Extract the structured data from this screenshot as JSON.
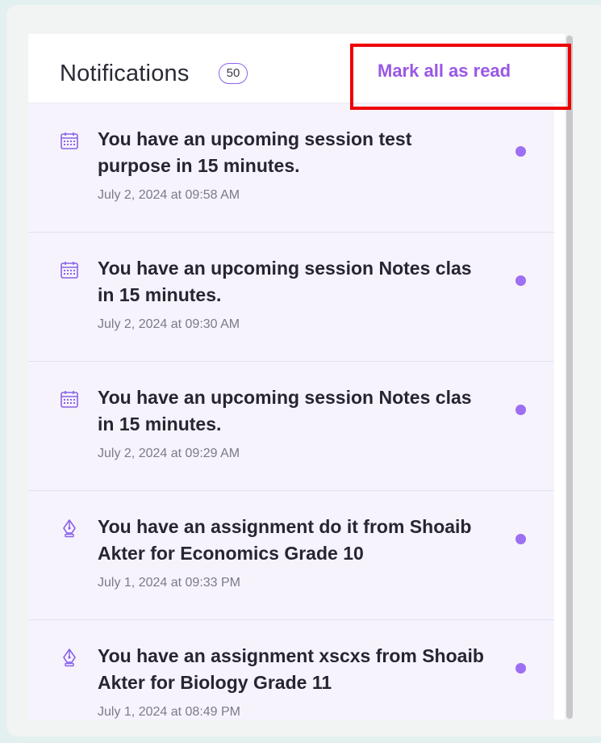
{
  "header": {
    "title": "Notifications",
    "count": "50",
    "mark_all_label": "Mark all as read"
  },
  "colors": {
    "accent": "#9a57e6",
    "unread_dot": "#9d6ff2",
    "list_background": "#f6f3fd",
    "highlight": "#ee0000"
  },
  "notifications": [
    {
      "icon": "calendar-icon",
      "message": "You have an upcoming session test purpose in 15 minutes.",
      "time": "July 2, 2024 at 09:58 AM",
      "unread": true
    },
    {
      "icon": "calendar-icon",
      "message": "You have an upcoming session Notes clas in 15 minutes.",
      "time": "July 2, 2024 at 09:30 AM",
      "unread": true
    },
    {
      "icon": "calendar-icon",
      "message": "You have an upcoming session Notes clas in 15 minutes.",
      "time": "July 2, 2024 at 09:29 AM",
      "unread": true
    },
    {
      "icon": "pen-nib-icon",
      "message": "You have an assignment do it from Shoaib Akter for Economics Grade 10",
      "time": "July 1, 2024 at 09:33 PM",
      "unread": true
    },
    {
      "icon": "pen-nib-icon",
      "message": "You have an assignment xscxs from Shoaib Akter for Biology Grade 11",
      "time": "July 1, 2024 at 08:49 PM",
      "unread": true
    }
  ]
}
